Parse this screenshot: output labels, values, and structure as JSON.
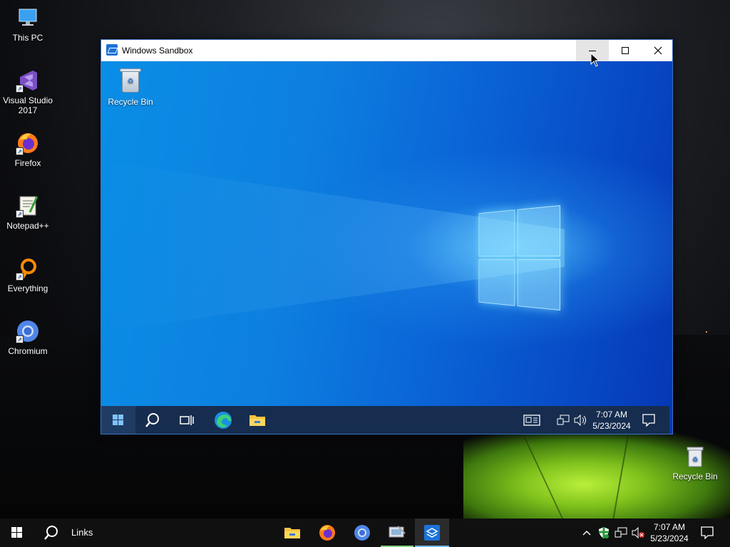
{
  "host_desktop": {
    "icons": [
      {
        "label": "This PC",
        "icon": "this-pc-icon"
      },
      {
        "label": "Visual Studio 2017",
        "icon": "visual-studio-icon"
      },
      {
        "label": "Firefox",
        "icon": "firefox-icon"
      },
      {
        "label": "Notepad++",
        "icon": "notepad-plus-plus-icon"
      },
      {
        "label": "Everything",
        "icon": "everything-icon"
      },
      {
        "label": "Chromium",
        "icon": "chromium-icon"
      },
      {
        "label": "Recycle Bin",
        "icon": "recycle-bin-icon"
      }
    ]
  },
  "sandbox_window": {
    "title": "Windows Sandbox",
    "guest_desktop": {
      "icons": [
        {
          "label": "Recycle Bin",
          "icon": "recycle-bin-icon"
        }
      ]
    },
    "guest_taskbar": {
      "buttons": [
        "start-icon",
        "search-icon",
        "task-view-icon",
        "edge-icon",
        "file-explorer-icon"
      ],
      "tray": [
        "news-icon",
        "network-icon",
        "volume-icon"
      ],
      "time": "7:07 AM",
      "date": "5/23/2024",
      "notifications_icon": "action-center-icon"
    }
  },
  "host_taskbar": {
    "links_label": "Links",
    "pinned": [
      "file-explorer-icon",
      "firefox-icon",
      "chromium-icon",
      "remote-desktop-icon",
      "windows-sandbox-icon"
    ],
    "active_item": "windows-sandbox-icon",
    "tray": [
      "chevron-up-icon",
      "defender-icon",
      "network-icon",
      "volume-muted-icon"
    ],
    "time": "7:07 AM",
    "date": "5/23/2024",
    "notifications_icon": "action-center-icon"
  },
  "colors": {
    "guest_taskbar": "#162d4f",
    "host_taskbar": "#101010",
    "accent": "#0a7fe0"
  }
}
